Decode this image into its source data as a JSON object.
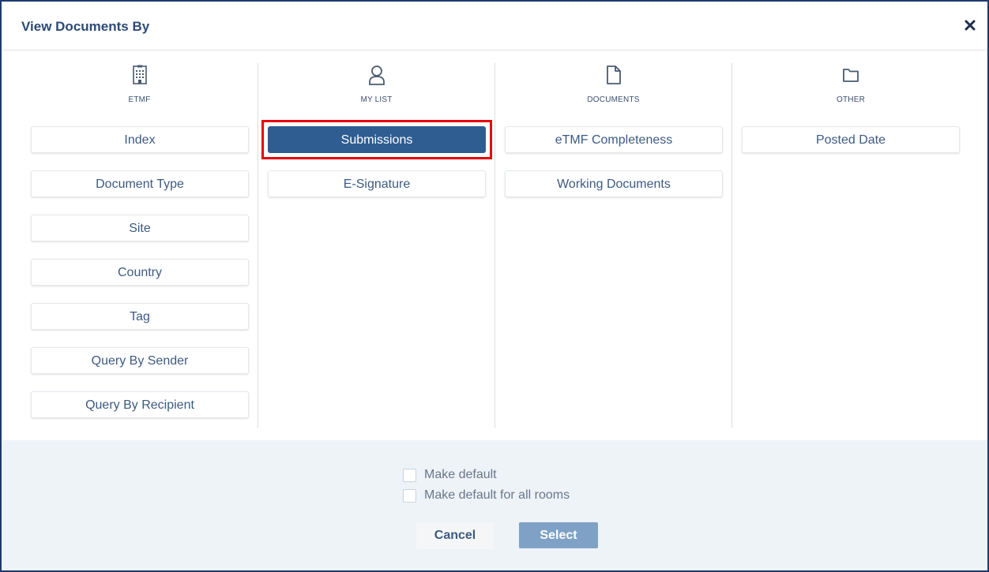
{
  "dialog": {
    "title": "View Documents By"
  },
  "columns": [
    {
      "label": "ETMF",
      "icon": "building-icon",
      "options": [
        "Index",
        "Document Type",
        "Site",
        "Country",
        "Tag",
        "Query By Sender",
        "Query By Recipient"
      ]
    },
    {
      "label": "MY LIST",
      "icon": "user-icon",
      "options": [
        "Submissions",
        "E-Signature"
      ],
      "selected": "Submissions"
    },
    {
      "label": "DOCUMENTS",
      "icon": "document-icon",
      "options": [
        "eTMF Completeness",
        "Working Documents"
      ]
    },
    {
      "label": "OTHER",
      "icon": "folder-icon",
      "options": [
        "Posted Date"
      ]
    }
  ],
  "footer": {
    "make_default_label": "Make default",
    "make_default_all_label": "Make default for all rooms",
    "cancel_label": "Cancel",
    "select_label": "Select"
  },
  "colors": {
    "accent": "#2f5d92",
    "title": "#2c4a77",
    "select_button": "#7fa1c6",
    "highlight": "#e8000b",
    "footer_bg": "#eef3f8"
  }
}
